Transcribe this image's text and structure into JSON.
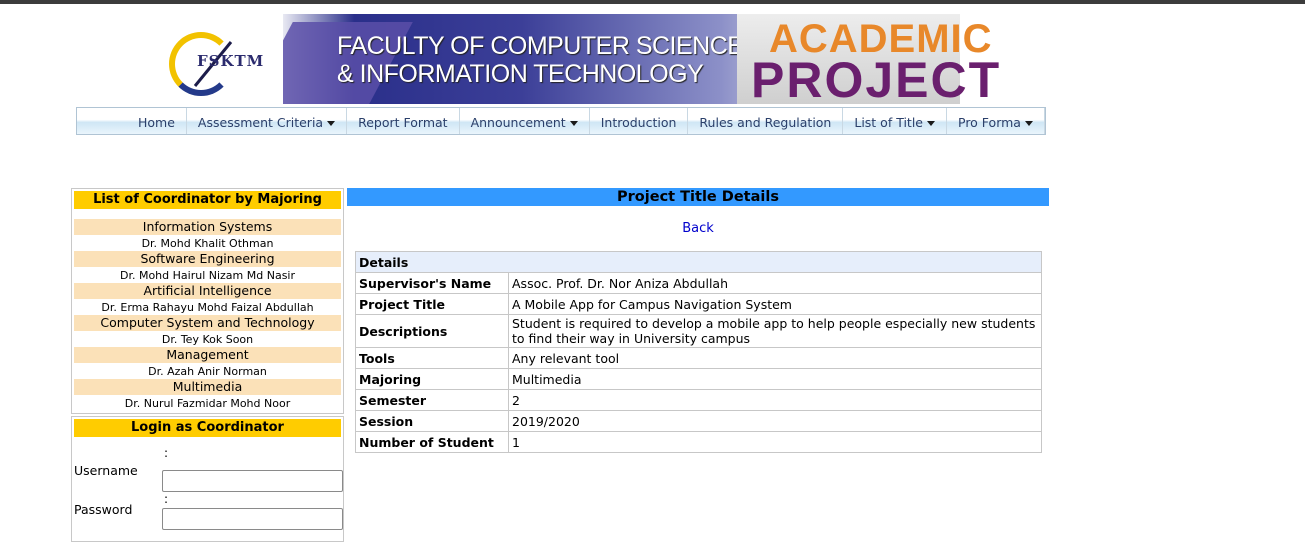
{
  "banner": {
    "logo_text": "FSKTM",
    "title_line1": "FACULTY OF COMPUTER SCIENCE",
    "title_line2": "& INFORMATION TECHNOLOGY",
    "badge_line1": "ACADEMIC",
    "badge_line2": "PROJECT"
  },
  "nav": {
    "items": [
      {
        "label": "Home",
        "dropdown": false
      },
      {
        "label": "Assessment Criteria",
        "dropdown": true
      },
      {
        "label": "Report Format",
        "dropdown": false
      },
      {
        "label": "Announcement",
        "dropdown": true
      },
      {
        "label": "Introduction",
        "dropdown": false
      },
      {
        "label": "Rules and Regulation",
        "dropdown": false
      },
      {
        "label": "List of Title",
        "dropdown": true
      },
      {
        "label": "Pro Forma",
        "dropdown": true
      }
    ]
  },
  "sidebar": {
    "coordinator_heading": "List of Coordinator by Majoring",
    "majors": [
      {
        "name": "Information Systems",
        "coordinator": "Dr. Mohd Khalit Othman"
      },
      {
        "name": "Software Engineering",
        "coordinator": "Dr. Mohd Hairul Nizam Md Nasir"
      },
      {
        "name": "Artificial Intelligence",
        "coordinator": "Dr. Erma Rahayu Mohd Faizal Abdullah"
      },
      {
        "name": "Computer System and Technology",
        "coordinator": "Dr. Tey Kok Soon"
      },
      {
        "name": "Management",
        "coordinator": "Dr. Azah Anir Norman"
      },
      {
        "name": "Multimedia",
        "coordinator": "Dr. Nurul Fazmidar Mohd Noor"
      }
    ],
    "login_heading": "Login as Coordinator",
    "username_label": "Username",
    "password_label": "Password",
    "colon": ":",
    "username_value": "",
    "password_value": ""
  },
  "main": {
    "heading": "Project Title Details",
    "back_label": "Back",
    "details_header": "Details",
    "rows": [
      {
        "label": "Supervisor's Name",
        "value": "Assoc. Prof. Dr. Nor Aniza Abdullah"
      },
      {
        "label": "Project Title",
        "value": "A Mobile App for Campus Navigation System"
      },
      {
        "label": "Descriptions",
        "value": "Student is required to develop a mobile app to help people especially new students to find their way in University campus"
      },
      {
        "label": "Tools",
        "value": "Any relevant tool"
      },
      {
        "label": "Majoring",
        "value": "Multimedia"
      },
      {
        "label": "Semester",
        "value": "2"
      },
      {
        "label": "Session",
        "value": "2019/2020"
      },
      {
        "label": "Number of Student",
        "value": "1"
      }
    ]
  }
}
